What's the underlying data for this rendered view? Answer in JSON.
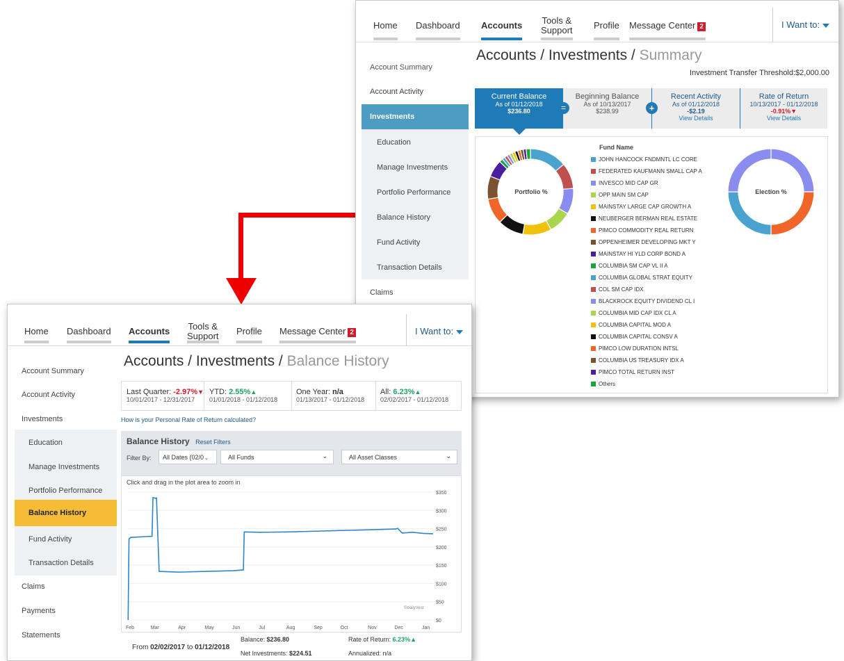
{
  "summary_window": {
    "nav": {
      "tabs": [
        "Home",
        "Dashboard",
        "Accounts",
        "Tools &",
        "Support",
        "Profile",
        "Message Center"
      ],
      "badge": "2",
      "i_want": "I Want to:"
    },
    "sidebar": [
      "Account Summary",
      "Account Activity",
      "Investments",
      "Education",
      "Manage Investments",
      "Portfolio Performance",
      "Balance History",
      "Fund Activity",
      "Transaction Details",
      "Claims"
    ],
    "title_main": "Accounts / Investments / ",
    "title_sub": "Summary",
    "threshold": "Investment Transfer Threshold:$2,000.00",
    "cards": [
      {
        "label": "Current Balance",
        "date": "As of 01/12/2018",
        "value": "$236.80"
      },
      {
        "label": "Beginning Balance",
        "date": "As of 10/13/2017",
        "value": "$238.99"
      },
      {
        "label": "Recent Activity",
        "date": "As of 01/12/2018",
        "value": "-$2.19",
        "link": "View Details"
      },
      {
        "label": "Rate of Return",
        "date": "10/13/2017 - 01/12/2018",
        "value": "-0.91%",
        "link": "View Details"
      }
    ],
    "ops": [
      "=",
      "+"
    ],
    "portfolio_label": "Portfolio %",
    "election_label": "Election %",
    "fund_header": "Fund Name",
    "funds": [
      {
        "name": "JOHN HANCOCK FNDMNTL LC CORE",
        "color": "#4aa3cf"
      },
      {
        "name": "FEDERATED KAUFMANN SMALL CAP A",
        "color": "#c0504d"
      },
      {
        "name": "INVESCO MID CAP GR",
        "color": "#8b8cf0"
      },
      {
        "name": "OPP MAIN SM CAP",
        "color": "#a9d54f"
      },
      {
        "name": "MAINSTAY LARGE CAP GROWTH A",
        "color": "#f2c10e"
      },
      {
        "name": "NEUBERGER BERMAN REAL ESTATE",
        "color": "#111111"
      },
      {
        "name": "PIMCO COMMODITY REAL RETURN",
        "color": "#f0662a"
      },
      {
        "name": "OPPENHEIMER DEVELOPING MKT Y",
        "color": "#7a5230"
      },
      {
        "name": "MAINSTAY HI YLD CORP BOND A",
        "color": "#4a1e9e"
      },
      {
        "name": "COLUMBIA SM CAP VL II A",
        "color": "#1ea33a"
      },
      {
        "name": "COLUMBIA GLOBAL STRAT EQUITY",
        "color": "#4aa3cf"
      },
      {
        "name": "COL SM CAP IDX",
        "color": "#c0504d"
      },
      {
        "name": "BLACKROCK EQUITY DIVIDEND CL I",
        "color": "#8b8cf0"
      },
      {
        "name": "COLUMBIA MID CAP IDX CL A",
        "color": "#a9d54f"
      },
      {
        "name": "COLUMBIA CAPITAL MOD A",
        "color": "#f2c10e"
      },
      {
        "name": "COLUMBIA CAPITAL CONSV A",
        "color": "#111111"
      },
      {
        "name": "PIMCO LOW DURATION INTSL",
        "color": "#f0662a"
      },
      {
        "name": "COLUMBIA US TREASURY IDX A",
        "color": "#7a5230"
      },
      {
        "name": "PIMCO TOTAL RETURN INST",
        "color": "#4a1e9e"
      },
      {
        "name": "Others",
        "color": "#1ea33a"
      }
    ]
  },
  "history_window": {
    "nav": {
      "tabs": [
        "Home",
        "Dashboard",
        "Accounts",
        "Tools &",
        "Support",
        "Profile",
        "Message Center"
      ],
      "badge": "2",
      "i_want": "I Want to:"
    },
    "sidebar": [
      "Account Summary",
      "Account Activity",
      "Investments",
      "Education",
      "Manage Investments",
      "Portfolio Performance",
      "Balance History",
      "Fund Activity",
      "Transaction Details",
      "Claims",
      "Payments",
      "Statements"
    ],
    "title_main": "Accounts / Investments / ",
    "title_sub": "Balance History",
    "stats": [
      {
        "label": "Last Quarter: ",
        "value": "-2.97%",
        "dir": "down",
        "range": "10/01/2017 - 12/31/2017"
      },
      {
        "label": "YTD: ",
        "value": "2.55%",
        "dir": "up",
        "range": "01/01/2018 - 01/12/2018"
      },
      {
        "label": "One Year: ",
        "value": "n/a",
        "dir": "none",
        "range": "01/13/2017 - 01/12/2018"
      },
      {
        "label": "All: ",
        "value": "6.23%",
        "dir": "up",
        "range": "02/02/2017 - 01/12/2018"
      }
    ],
    "ror_link": "How is your Personal Rate of Return calculated?",
    "panel_title": "Balance History",
    "reset": "Reset Filters",
    "filter_by": "Filter By:",
    "filters": [
      "All Dates (02/0",
      "All Funds",
      "All Asset Classes"
    ],
    "chart_hint": "Click and drag in the plot area to zoom in",
    "watermark": "©dailyVest",
    "footer": {
      "from_label": "From ",
      "from": "02/02/2017",
      "to_label": " to ",
      "to": "01/12/2018",
      "balance_label": "Balance: ",
      "balance": "$236.80",
      "netinv_label": "Net Investments: ",
      "netinv": "$224.51",
      "ror_label": "Rate of Return: ",
      "ror": "6.23%",
      "annual_label": "Annualized: ",
      "annual": "n/a"
    }
  },
  "chart_data": {
    "type": "line",
    "title": "",
    "ylim": [
      0,
      350
    ],
    "yticks": [
      "$0",
      "$50",
      "$100",
      "$150",
      "$200",
      "$250",
      "$300",
      "$350"
    ],
    "xticks": [
      "Feb",
      "Mar",
      "Apr",
      "May",
      "Jun",
      "Jul",
      "Aug",
      "Sep",
      "Oct",
      "Nov",
      "Dec",
      "Jan"
    ],
    "series": [
      {
        "x": [
          "Feb 2",
          "Feb 3",
          "Feb 5",
          "Feb 20",
          "Mar 1",
          "Mar 2",
          "Mar 5",
          "Mar 6",
          "Mar 9",
          "Apr 1",
          "May 1",
          "Jun 1",
          "Jun 12",
          "Jun 13",
          "Jul 1",
          "Aug 1",
          "Sep 1",
          "Oct 1",
          "Nov 1",
          "Dec 1",
          "Dec 3",
          "Dec 8",
          "Dec 20",
          "Jan 1",
          "Jan 12"
        ],
        "y": [
          0,
          222,
          226,
          228,
          229,
          335,
          333,
          334,
          133,
          131,
          133,
          135,
          137,
          241,
          240,
          241,
          243,
          245,
          247,
          249,
          251,
          238,
          240,
          237,
          236
        ]
      }
    ]
  }
}
